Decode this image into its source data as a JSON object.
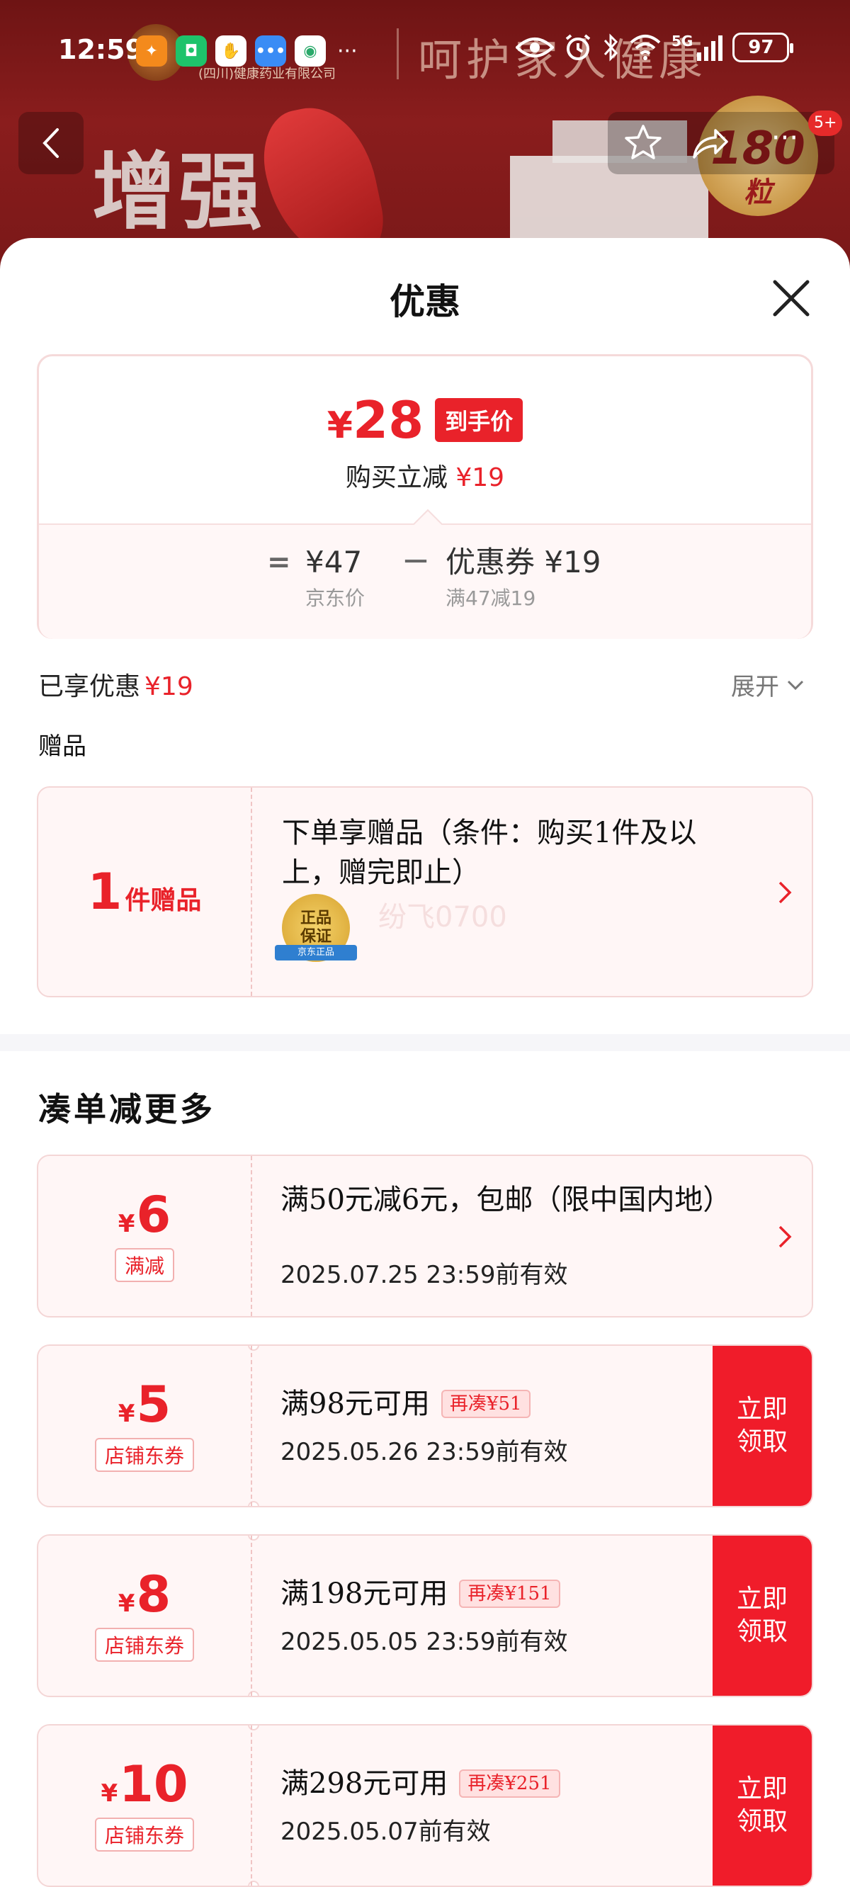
{
  "status_bar": {
    "time": "12:59",
    "battery": "97",
    "network": "5G"
  },
  "background": {
    "brand_sub": "(四川)健康药业有限公司",
    "slogan": "呵护家人健康",
    "banner_text": "增强",
    "seal_number": "180",
    "seal_unit": "粒"
  },
  "nav": {
    "more_badge": "5+"
  },
  "sheet": {
    "title": "优惠"
  },
  "summary": {
    "final_price_yen": "¥",
    "final_price": "28",
    "final_tag": "到手价",
    "instant_label": "购买立减",
    "instant_value": "¥19",
    "formula": {
      "eq": "=",
      "minus": "－",
      "jd_price": "¥47",
      "jd_price_label": "京东价",
      "coupon": "优惠券 ¥19",
      "coupon_label": "满47减19"
    }
  },
  "enjoyed": {
    "label": "已享优惠",
    "value": "¥19",
    "expand_label": "展开"
  },
  "gift": {
    "heading": "赠品",
    "count": "1",
    "unit": "件赠品",
    "desc": "下单享赠品（条件：购买1件及以上，赠完即止）",
    "badge_line1": "正品",
    "badge_line2": "保证",
    "badge_ribbon": "京东正品",
    "watermark": "纷飞0700"
  },
  "more_section": {
    "heading": "凑单减更多",
    "coupons": [
      {
        "yen": "¥",
        "amount": "6",
        "tag": "满减",
        "condition": "满50元减6元，包邮（限中国内地）",
        "valid": "2025.07.25 23:59前有效"
      },
      {
        "yen": "¥",
        "amount": "5",
        "tag": "店铺东券",
        "condition": "满98元可用",
        "more": "再凑¥51",
        "valid": "2025.05.26 23:59前有效",
        "claim": "立即领取"
      },
      {
        "yen": "¥",
        "amount": "8",
        "tag": "店铺东券",
        "condition": "满198元可用",
        "more": "再凑¥151",
        "valid": "2025.05.05 23:59前有效",
        "claim": "立即领取"
      },
      {
        "yen": "¥",
        "amount": "10",
        "tag": "店铺东券",
        "condition": "满298元可用",
        "more": "再凑¥251",
        "valid": "2025.05.07前有效",
        "claim": "立即领取"
      }
    ]
  },
  "colors": {
    "accent_red": "#e9222a",
    "claim_red": "#f01c2a",
    "card_bg": "#fff6f6"
  }
}
